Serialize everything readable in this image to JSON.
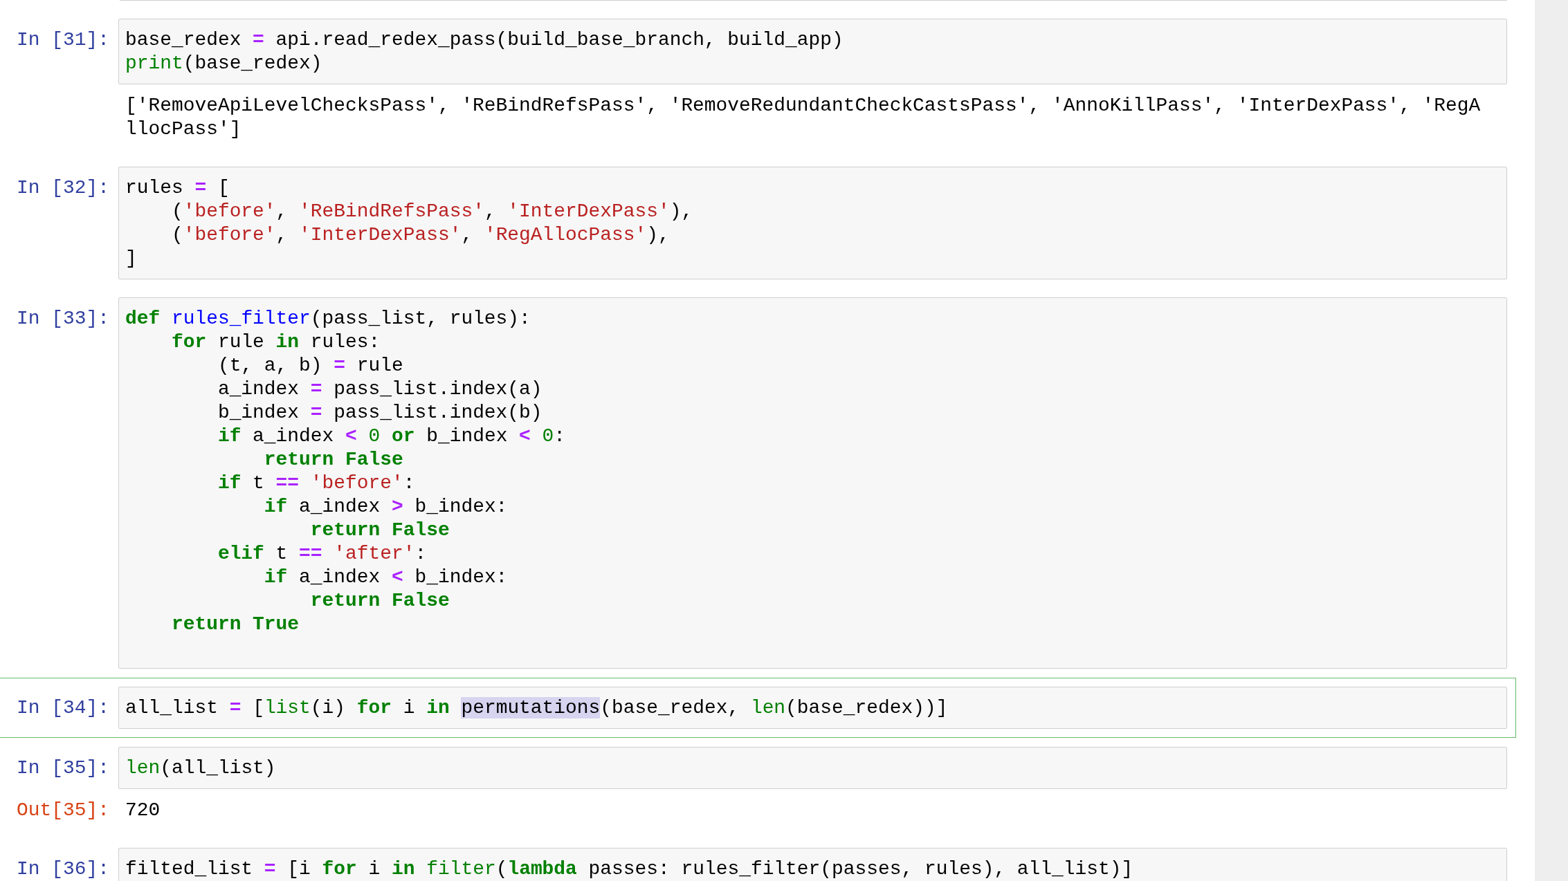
{
  "cells": [
    {
      "prompt": "In [31]:",
      "selected": false,
      "lines": [
        [
          {
            "text": "base_redex ",
            "kind": "name"
          },
          {
            "text": "=",
            "kind": "operator"
          },
          {
            "text": " api.read_redex_pass(build_base_branch, build_app)",
            "kind": "name"
          }
        ],
        [
          {
            "text": "print",
            "kind": "builtin"
          },
          {
            "text": "(base_redex)",
            "kind": "name"
          }
        ]
      ],
      "output": {
        "kind": "stream",
        "lines": [
          "['RemoveApiLevelChecksPass', 'ReBindRefsPass', 'RemoveRedundantCheckCastsPass', 'AnnoKillPass', 'InterDexPass', 'RegA",
          "llocPass']"
        ]
      }
    },
    {
      "prompt": "In [32]:",
      "selected": false,
      "lines": [
        [
          {
            "text": "rules ",
            "kind": "name"
          },
          {
            "text": "=",
            "kind": "operator"
          },
          {
            "text": " [",
            "kind": "name"
          }
        ],
        [
          {
            "text": "    (",
            "kind": "name"
          },
          {
            "text": "'before'",
            "kind": "string"
          },
          {
            "text": ", ",
            "kind": "name"
          },
          {
            "text": "'ReBindRefsPass'",
            "kind": "string"
          },
          {
            "text": ", ",
            "kind": "name"
          },
          {
            "text": "'InterDexPass'",
            "kind": "string"
          },
          {
            "text": "),",
            "kind": "name"
          }
        ],
        [
          {
            "text": "    (",
            "kind": "name"
          },
          {
            "text": "'before'",
            "kind": "string"
          },
          {
            "text": ", ",
            "kind": "name"
          },
          {
            "text": "'InterDexPass'",
            "kind": "string"
          },
          {
            "text": ", ",
            "kind": "name"
          },
          {
            "text": "'RegAllocPass'",
            "kind": "string"
          },
          {
            "text": "),",
            "kind": "name"
          }
        ],
        [
          {
            "text": "]",
            "kind": "name"
          }
        ]
      ]
    },
    {
      "prompt": "In [33]:",
      "selected": false,
      "trailing_blank_line": true,
      "lines": [
        [
          {
            "text": "def",
            "kind": "keyword"
          },
          {
            "text": " rules_filter",
            "kind": "defname"
          },
          {
            "text": "(pass_list, rules):",
            "kind": "name"
          }
        ],
        [
          {
            "text": "    for",
            "kind": "keyword"
          },
          {
            "text": " rule ",
            "kind": "name"
          },
          {
            "text": "in",
            "kind": "keyword"
          },
          {
            "text": " rules:",
            "kind": "name"
          }
        ],
        [
          {
            "text": "        (t, a, b) ",
            "kind": "name"
          },
          {
            "text": "=",
            "kind": "operator"
          },
          {
            "text": " rule",
            "kind": "name"
          }
        ],
        [
          {
            "text": "        a_index ",
            "kind": "name"
          },
          {
            "text": "=",
            "kind": "operator"
          },
          {
            "text": " pass_list.index(a)",
            "kind": "name"
          }
        ],
        [
          {
            "text": "        b_index ",
            "kind": "name"
          },
          {
            "text": "=",
            "kind": "operator"
          },
          {
            "text": " pass_list.index(b)",
            "kind": "name"
          }
        ],
        [
          {
            "text": "        if",
            "kind": "keyword"
          },
          {
            "text": " a_index ",
            "kind": "name"
          },
          {
            "text": "<",
            "kind": "operator"
          },
          {
            "text": " 0",
            "kind": "number"
          },
          {
            "text": " or",
            "kind": "keyword"
          },
          {
            "text": " b_index ",
            "kind": "name"
          },
          {
            "text": "<",
            "kind": "operator"
          },
          {
            "text": " 0",
            "kind": "number"
          },
          {
            "text": ":",
            "kind": "name"
          }
        ],
        [
          {
            "text": "            return False",
            "kind": "keyword"
          }
        ],
        [
          {
            "text": "        if",
            "kind": "keyword"
          },
          {
            "text": " t ",
            "kind": "name"
          },
          {
            "text": "==",
            "kind": "operator"
          },
          {
            "text": " 'before'",
            "kind": "string"
          },
          {
            "text": ":",
            "kind": "name"
          }
        ],
        [
          {
            "text": "            if",
            "kind": "keyword"
          },
          {
            "text": " a_index ",
            "kind": "name"
          },
          {
            "text": ">",
            "kind": "operator"
          },
          {
            "text": " b_index:",
            "kind": "name"
          }
        ],
        [
          {
            "text": "                return False",
            "kind": "keyword"
          }
        ],
        [
          {
            "text": "        elif",
            "kind": "keyword"
          },
          {
            "text": " t ",
            "kind": "name"
          },
          {
            "text": "==",
            "kind": "operator"
          },
          {
            "text": " 'after'",
            "kind": "string"
          },
          {
            "text": ":",
            "kind": "name"
          }
        ],
        [
          {
            "text": "            if",
            "kind": "keyword"
          },
          {
            "text": " a_index ",
            "kind": "name"
          },
          {
            "text": "<",
            "kind": "operator"
          },
          {
            "text": " b_index:",
            "kind": "name"
          }
        ],
        [
          {
            "text": "                return False",
            "kind": "keyword"
          }
        ],
        [
          {
            "text": "    return True",
            "kind": "keyword"
          }
        ]
      ]
    },
    {
      "prompt": "In [34]:",
      "selected": true,
      "lines": [
        [
          {
            "text": "all_list ",
            "kind": "name"
          },
          {
            "text": "=",
            "kind": "operator"
          },
          {
            "text": " [",
            "kind": "name"
          },
          {
            "text": "list",
            "kind": "builtin"
          },
          {
            "text": "(i) ",
            "kind": "name"
          },
          {
            "text": "for",
            "kind": "keyword"
          },
          {
            "text": " i ",
            "kind": "name"
          },
          {
            "text": "in ",
            "kind": "keyword"
          },
          {
            "text": "permutations",
            "kind": "name",
            "highlighted": true
          },
          {
            "text": "(base_redex, ",
            "kind": "name"
          },
          {
            "text": "len",
            "kind": "builtin"
          },
          {
            "text": "(base_redex))]",
            "kind": "name"
          }
        ]
      ]
    },
    {
      "prompt": "In [35]:",
      "selected": false,
      "lines": [
        [
          {
            "text": "len",
            "kind": "builtin"
          },
          {
            "text": "(all_list)",
            "kind": "name"
          }
        ]
      ],
      "output": {
        "kind": "result",
        "prompt": "Out[35]:",
        "lines": [
          "720"
        ]
      }
    },
    {
      "prompt": "In [36]:",
      "selected": false,
      "lines": [
        [
          {
            "text": "filted_list ",
            "kind": "name"
          },
          {
            "text": "=",
            "kind": "operator"
          },
          {
            "text": " [i ",
            "kind": "name"
          },
          {
            "text": "for",
            "kind": "keyword"
          },
          {
            "text": " i ",
            "kind": "name"
          },
          {
            "text": "in",
            "kind": "keyword"
          },
          {
            "text": " filter",
            "kind": "builtin"
          },
          {
            "text": "(",
            "kind": "name"
          },
          {
            "text": "lambda",
            "kind": "keyword"
          },
          {
            "text": " passes: rules_filter(passes, rules), all_list)]",
            "kind": "name"
          }
        ]
      ]
    }
  ]
}
